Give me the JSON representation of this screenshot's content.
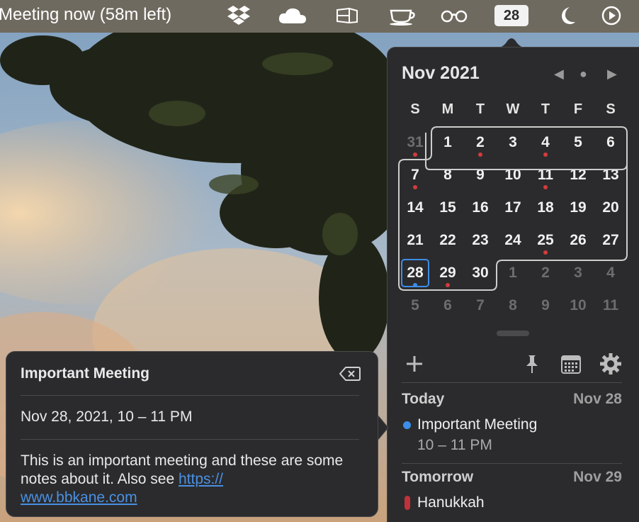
{
  "menubar": {
    "title": "Meeting now (58m left)",
    "date_badge": "28",
    "icons": [
      "dropbox-icon",
      "cloud-icon",
      "window-icon",
      "cup-icon",
      "glasses-icon",
      "calendar-date-badge",
      "moon-icon",
      "play-icon"
    ]
  },
  "calendar": {
    "month": "Nov 2021",
    "weekdays": [
      "S",
      "M",
      "T",
      "W",
      "T",
      "F",
      "S"
    ],
    "weeks": [
      [
        "31",
        "1",
        "2",
        "3",
        "4",
        "5",
        "6"
      ],
      [
        "7",
        "8",
        "9",
        "10",
        "11",
        "12",
        "13"
      ],
      [
        "14",
        "15",
        "16",
        "17",
        "18",
        "19",
        "20"
      ],
      [
        "21",
        "22",
        "23",
        "24",
        "25",
        "26",
        "27"
      ],
      [
        "28",
        "29",
        "30",
        "1",
        "2",
        "3",
        "4"
      ],
      [
        "5",
        "6",
        "7",
        "8",
        "9",
        "10",
        "11"
      ]
    ],
    "today": "28",
    "colors": {
      "accent": "#3d8ee9",
      "event_dot": "#d23c3c",
      "panel_bg": "#2b2b2d"
    }
  },
  "toolbar": {
    "add_icon": "plus-icon",
    "pin_icon": "pin-icon",
    "calendar_icon": "calendar-grid-icon",
    "settings_icon": "gear-icon"
  },
  "agenda": {
    "today_label": "Today",
    "today_date": "Nov 28",
    "today_event_title": "Important Meeting",
    "today_event_time": "10 – 11 PM",
    "tomorrow_label": "Tomorrow",
    "tomorrow_date": "Nov 29",
    "tomorrow_event_title": "Hanukkah",
    "tomorrow_event_color": "#c0323a"
  },
  "popover": {
    "title": "Important Meeting",
    "date": "Nov 28, 2021, 10 – 11 PM",
    "notes_prefix": "This is an important meeting and these are some notes about it. Also see ",
    "link": "https://\nwww.bbkane.com"
  }
}
